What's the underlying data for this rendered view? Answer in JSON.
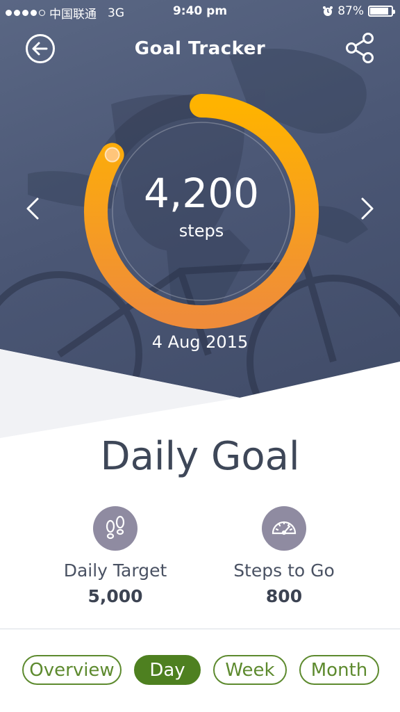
{
  "status_bar": {
    "carrier": "中国联通",
    "network": "3G",
    "time": "9:40 pm",
    "battery": "87%",
    "battery_level": 0.87,
    "signal_strength": 4
  },
  "header": {
    "title": "Goal Tracker",
    "back_icon": "arrow-left-icon",
    "share_icon": "share-icon"
  },
  "progress": {
    "value": "4,200",
    "unit": "steps",
    "fraction": 0.84,
    "date": "4 Aug 2015",
    "ring_color_start": "#ffb300",
    "ring_color_end": "#ef8c3a"
  },
  "goal": {
    "title": "Daily Goal",
    "target": {
      "label": "Daily Target",
      "value": "5,000",
      "icon": "footprints-icon"
    },
    "remaining": {
      "label": "Steps to Go",
      "value": "800",
      "icon": "speedometer-icon"
    }
  },
  "tabs": [
    {
      "label": "Overview",
      "active": false
    },
    {
      "label": "Day",
      "active": true
    },
    {
      "label": "Week",
      "active": false
    },
    {
      "label": "Month",
      "active": false
    }
  ],
  "colors": {
    "accent_green": "#4e8020",
    "icon_circle": "#8f8ba1",
    "hero_bg": "#4b5775"
  }
}
